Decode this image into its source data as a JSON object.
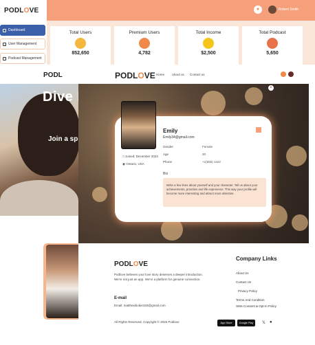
{
  "admin": {
    "brand": {
      "prefix": "P",
      "mid": "ODL",
      "o": "O",
      "suffix": "VE"
    },
    "user_name": "Robert Smith",
    "bell_icon": "bell-icon",
    "sidebar": [
      {
        "label": "Dashboard",
        "active": true
      },
      {
        "label": "User Management",
        "active": false
      },
      {
        "label": "Podcast Management",
        "active": false
      }
    ],
    "stats": [
      {
        "label": "Total Users",
        "value": "852,650",
        "icon": "users-icon",
        "color": "#f4b73f"
      },
      {
        "label": "Premium Users",
        "value": "4,782",
        "icon": "premium-icon",
        "color": "#f08a4b"
      },
      {
        "label": "Total Income",
        "value": "$2,500",
        "icon": "coin-icon",
        "color": "#f5c518"
      },
      {
        "label": "Total Podcast",
        "value": "5,650",
        "icon": "mic-icon",
        "color": "#e8734a"
      }
    ]
  },
  "site": {
    "brand": {
      "prefix": "PODL",
      "o": "O",
      "suffix": "VE"
    },
    "nav": [
      "Home",
      "About us",
      "Contact us"
    ],
    "hero_title": "Dive I",
    "hero_sub": "Join a sp",
    "profile": {
      "name": "Emily",
      "email": "Emily34@gmail.com",
      "gender_label": "Gender",
      "gender": "Female",
      "age_label": "Age",
      "age": "30",
      "phone_label": "Phone",
      "phone": "+1(555) 1422",
      "joined": "Joined: December 2023",
      "location": "Ontario, USA",
      "bio_label": "Bio",
      "bio": "Write a few lines about yourself and your character. Tell us about your achievements, priorities and life experience. This way your profile will become more interesting and attract more attention."
    },
    "footer": {
      "description": "Podlove believes your love story deserves a deeper introduction. We're not just an app. We're a platform for genuine connection.",
      "email_heading": "E-mail",
      "email": "Email: matthewboker333@gmail.com",
      "copyright": "All Rights Reserved, Copyright © 2025 Podlove",
      "links_heading": "Company Links",
      "links": [
        "About Us",
        "Contact Us",
        "Privacy Policy",
        "Terms And Condition",
        "SMS Consent & Opt-In Policy"
      ],
      "stores": [
        "App Store",
        "Google Play"
      ]
    }
  }
}
